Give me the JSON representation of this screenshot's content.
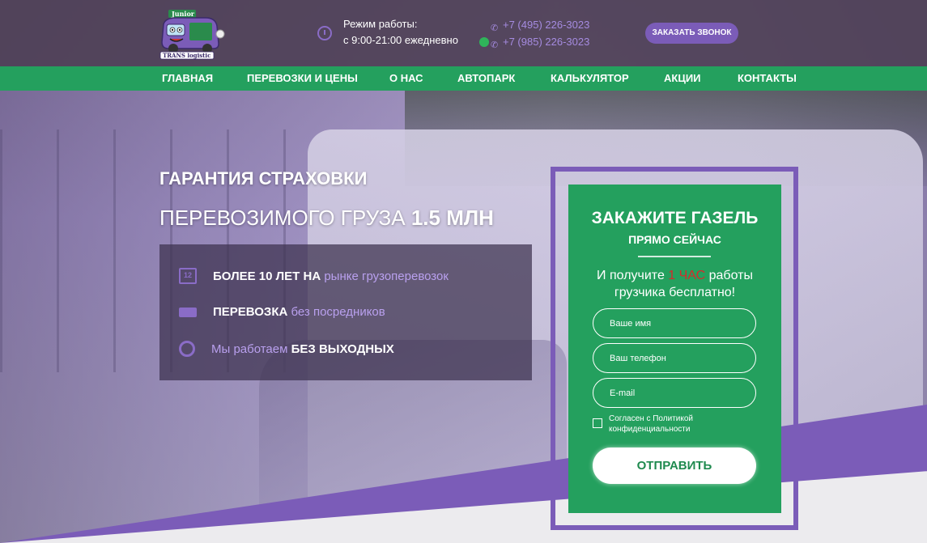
{
  "header": {
    "logo_alt": "Junior TRANS logistic",
    "hours_label": "Режим работы:",
    "hours_value": "с 9:00-21:00 ежедневно",
    "phone1": "+7 (495) 226-3023",
    "phone2": "+7 (985) 226-3023",
    "call_button": "ЗАКАЗАТЬ ЗВОНОК"
  },
  "nav": {
    "items": [
      {
        "label": "ГЛАВНАЯ"
      },
      {
        "label": "ПЕРЕВОЗКИ И ЦЕНЫ"
      },
      {
        "label": "О НАС"
      },
      {
        "label": "АВТОПАРК"
      },
      {
        "label": "КАЛЬКУЛЯТОР"
      },
      {
        "label": "АКЦИИ"
      },
      {
        "label": "КОНТАКТЫ"
      }
    ]
  },
  "hero": {
    "title": "ГАРАНТИЯ СТРАХОВКИ",
    "subtitle_prefix": "ПЕРЕВОЗИМОГО ГРУЗА ",
    "subtitle_bold": "1.5 МЛН",
    "features": [
      {
        "icon": "calendar-icon",
        "icon_text": "12",
        "strong": "БОЛЕЕ 10 ЛЕТ НА ",
        "soft": "рынке грузоперевозок",
        "strong_after": ""
      },
      {
        "icon": "truck-icon",
        "icon_text": "",
        "strong": "ПЕРЕВОЗКА ",
        "soft": "без посредников",
        "strong_after": ""
      },
      {
        "icon": "stopwatch-icon",
        "icon_text": "",
        "strong": "",
        "soft": "Мы работаем ",
        "strong_after": "БЕЗ ВЫХОДНЫХ"
      }
    ]
  },
  "form": {
    "title": "ЗАКАЖИТЕ ГАЗЕЛЬ",
    "subtitle": "ПРЯМО СЕЙЧАС",
    "offer_prefix": "И получите ",
    "offer_highlight": "1 ЧАС",
    "offer_suffix": " работы грузчика бесплатно!",
    "name_placeholder": "Ваше имя",
    "phone_placeholder": "Ваш телефон",
    "email_placeholder": "E-mail",
    "consent": "Согласен с Политикой конфиденциальности",
    "submit": "ОТПРАВИТЬ"
  },
  "colors": {
    "green": "#24a05e",
    "purple": "#7b5cb8",
    "highlight_red": "#d62b2b",
    "soft_purple_text": "#b9a0ee"
  }
}
